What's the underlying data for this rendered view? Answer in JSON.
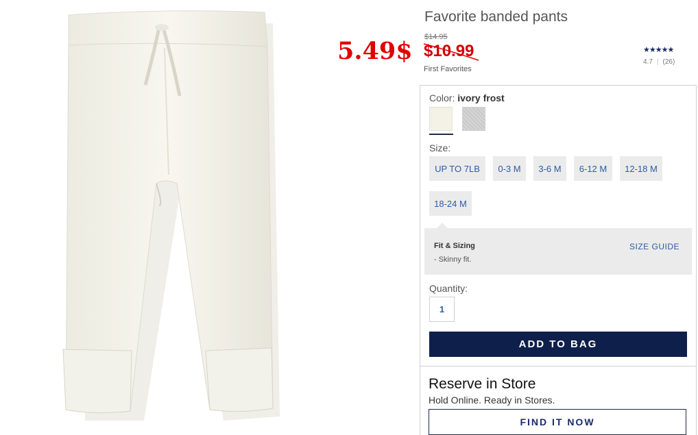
{
  "product": {
    "title": "Favorite banded pants",
    "original_price": "$14.95",
    "sale_price": "$10.99",
    "overlay_price": "5.49$",
    "collection": "First Favorites",
    "rating": {
      "stars_display": "★★★★★",
      "value": "4.7",
      "count": "(26)"
    }
  },
  "options": {
    "color_label": "Color:",
    "color_selected": "ivory frost",
    "swatches": [
      {
        "name": "ivory frost",
        "color": "#f4f2e6",
        "selected": true
      },
      {
        "name": "grey heather",
        "color": "#cfcfcf",
        "selected": false
      }
    ],
    "size_label": "Size:",
    "sizes": [
      "UP TO 7LB",
      "0-3 M",
      "3-6 M",
      "6-12 M",
      "12-18 M",
      "18-24 M"
    ],
    "fit": {
      "title": "Fit & Sizing",
      "note": "- Skinny fit.",
      "guide_label": "SIZE GUIDE"
    },
    "quantity_label": "Quantity:",
    "quantity_value": "1",
    "add_to_bag_label": "ADD TO BAG"
  },
  "reserve": {
    "title": "Reserve in Store",
    "subtitle": "Hold Online. Ready in Stores.",
    "button_label": "FIND IT NOW"
  },
  "colors": {
    "primary_navy": "#0f1f4b",
    "link_blue": "#2a5ba8",
    "sale_red": "#d40000"
  }
}
